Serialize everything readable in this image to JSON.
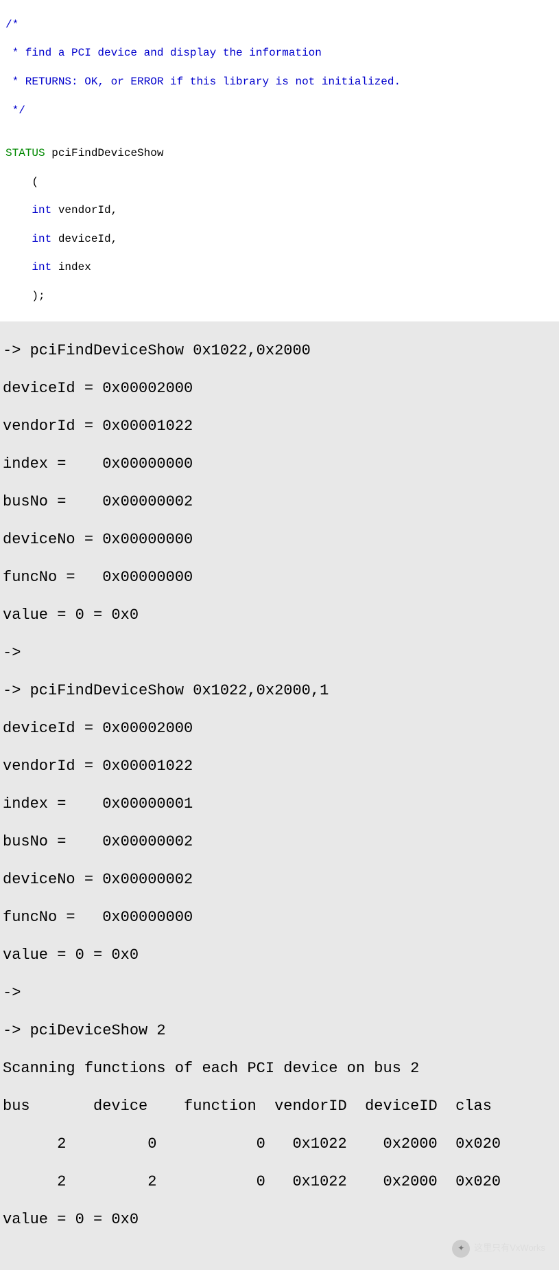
{
  "code": {
    "c1": "/*",
    "c2": " * find a PCI device and display the information",
    "c3": " * RETURNS: OK, or ERROR if this library is not initialized.",
    "c4": " */",
    "blank": "",
    "return_type": "STATUS",
    "space": " ",
    "func_name": "pciFindDeviceShow",
    "paren_open": "    (",
    "type_int": "int",
    "arg1": " vendorId,",
    "arg2": " deviceId,",
    "arg3": " index",
    "paren_close": "    );",
    "indent": "    "
  },
  "terminal": {
    "l1": "-> pciFindDeviceShow 0x1022,0x2000",
    "l2": "deviceId = 0x00002000",
    "l3": "vendorId = 0x00001022",
    "l4": "index =    0x00000000",
    "l5": "busNo =    0x00000002",
    "l6": "deviceNo = 0x00000000",
    "l7": "funcNo =   0x00000000",
    "l8": "value = 0 = 0x0",
    "l9": "->",
    "l10": "-> pciFindDeviceShow 0x1022,0x2000,1",
    "l11": "deviceId = 0x00002000",
    "l12": "vendorId = 0x00001022",
    "l13": "index =    0x00000001",
    "l14": "busNo =    0x00000002",
    "l15": "deviceNo = 0x00000002",
    "l16": "funcNo =   0x00000000",
    "l17": "value = 0 = 0x0",
    "l18": "->",
    "l19": "-> pciDeviceShow 2",
    "l20": "Scanning functions of each PCI device on bus 2",
    "l21": "bus       device    function  vendorID  deviceID  clas",
    "l22": "      2         0           0   0x1022    0x2000  0x020",
    "l23": "      2         2           0   0x1022    0x2000  0x020",
    "l24": "value = 0 = 0x0"
  },
  "watermark_text": "这里只有VxWorks"
}
